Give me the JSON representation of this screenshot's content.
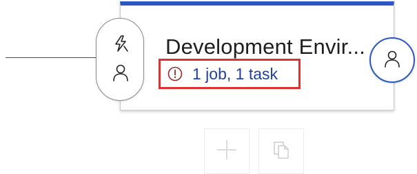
{
  "stage": {
    "name": "Development Envir...",
    "jobs_summary": "1 job, 1 task",
    "accent_color": "#2a56c6",
    "warning_color": "#a4262c",
    "link_color": "#1f3fa8",
    "highlight_color": "#e03131"
  },
  "pre_deployment": {
    "trigger_icon": "lightning-bolt-icon",
    "approvals_icon": "person-icon"
  },
  "post_deployment": {
    "approvals_icon": "person-icon"
  },
  "actions": {
    "add_icon": "plus-icon",
    "clone_icon": "copy-icon"
  }
}
